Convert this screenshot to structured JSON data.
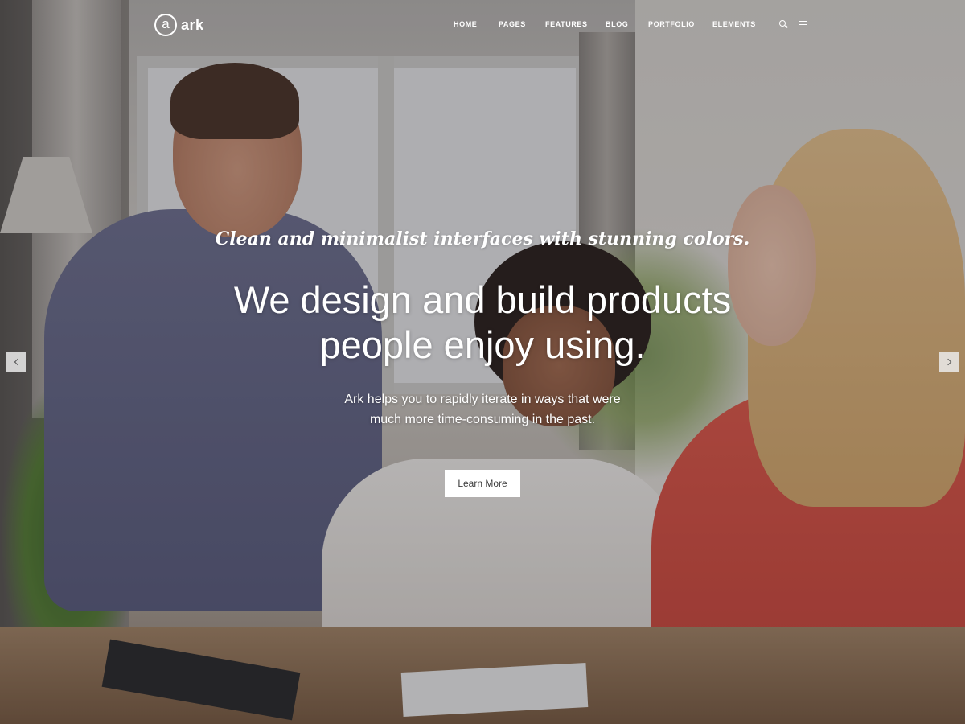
{
  "brand": {
    "logo_letter": "a",
    "name": "ark"
  },
  "nav": {
    "items": [
      {
        "label": "HOME"
      },
      {
        "label": "PAGES"
      },
      {
        "label": "FEATURES"
      },
      {
        "label": "BLOG"
      },
      {
        "label": "PORTFOLIO"
      },
      {
        "label": "ELEMENTS"
      }
    ],
    "icons": [
      "search-icon",
      "menu-icon"
    ]
  },
  "hero": {
    "tagline": "Clean and minimalist interfaces with stunning colors.",
    "headline_line1": "We design and build products",
    "headline_line2": "people enjoy using.",
    "description_line1": "Ark helps you to rapidly iterate in ways that were",
    "description_line2": "much more time-consuming in the past.",
    "cta_label": "Learn More"
  },
  "slider": {
    "prev_icon": "chevron-left-icon",
    "next_icon": "chevron-right-icon"
  },
  "colors": {
    "text": "#ffffff",
    "button_bg": "#ffffff",
    "button_text": "#3b3b3b"
  }
}
